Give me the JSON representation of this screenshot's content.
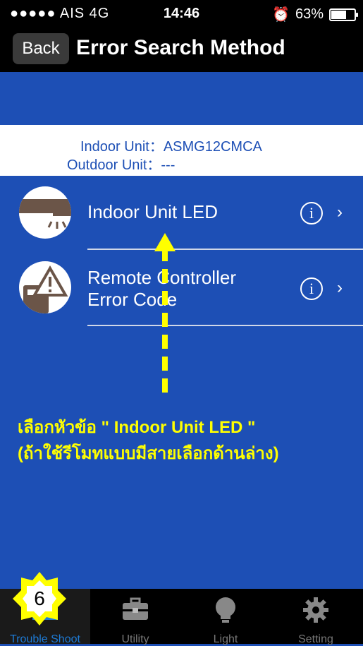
{
  "status_bar": {
    "carrier": "●●●●● AIS  4G",
    "time": "14:46",
    "battery_text": "63%",
    "battery_level": 0.63,
    "alarm_icon": "alarm-icon"
  },
  "nav": {
    "back_label": "Back",
    "title": "Error Search Method"
  },
  "unit_info": {
    "indoor_label": "Indoor Unit：",
    "indoor_value": "ASMG12CMCA",
    "outdoor_label": "Outdoor Unit：",
    "outdoor_value": "---"
  },
  "menu": [
    {
      "label": "Indoor Unit LED",
      "icon": "indoor-unit-led-icon"
    },
    {
      "label_line1": "Remote Controller",
      "label_line2": "Error Code",
      "icon": "remote-error-icon"
    }
  ],
  "annotation": {
    "line1": "เลือกหัวข้อ \" Indoor Unit LED \"",
    "line2": "(ถ้าใช้รีโมทแบบมีสายเลือกด้านล่าง)"
  },
  "badge": "6",
  "tabs": [
    {
      "label": "Trouble Shoot",
      "icon": "trouble-shoot-icon",
      "active": true
    },
    {
      "label": "Utility",
      "icon": "toolbox-icon"
    },
    {
      "label": "Light",
      "icon": "lightbulb-icon"
    },
    {
      "label": "Setting",
      "icon": "gear-icon"
    }
  ],
  "colors": {
    "primary_blue": "#1d4fb5",
    "annotation_yellow": "#ffff00",
    "active_tab": "#1e7bd6"
  }
}
